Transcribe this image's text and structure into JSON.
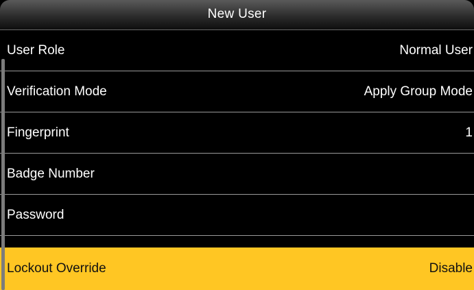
{
  "title": "New User",
  "colors": {
    "background": "#000000",
    "highlight": "#ffc623",
    "text": "#ffffff",
    "divider": "#9a9a9a"
  },
  "menu": {
    "items": [
      {
        "label": "User Role",
        "value": "Normal User"
      },
      {
        "label": "Verification Mode",
        "value": "Apply Group Mode"
      },
      {
        "label": "Fingerprint",
        "value": "1"
      },
      {
        "label": "Badge Number",
        "value": ""
      },
      {
        "label": "Password",
        "value": ""
      },
      {
        "label": "Lockout Override",
        "value": "Disable",
        "selected": true
      }
    ]
  }
}
